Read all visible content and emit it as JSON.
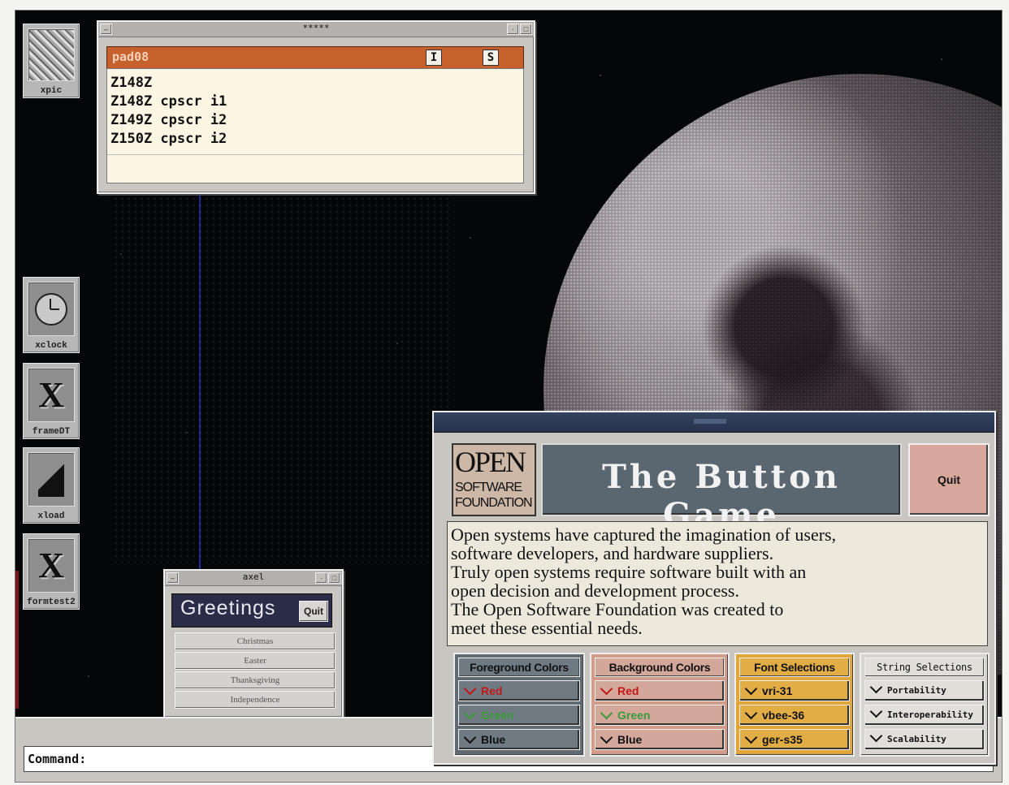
{
  "desktop": {
    "icons": [
      {
        "label": "xpic",
        "icon": "xpic-image-icon"
      },
      {
        "label": "xclock",
        "icon": "clock-icon"
      },
      {
        "label": "frameDT",
        "icon": "x-logo-icon"
      },
      {
        "label": "xload",
        "icon": "load-graph-icon"
      },
      {
        "label": "formtest2",
        "icon": "x-logo-icon"
      }
    ],
    "x_glyph": "X"
  },
  "pad_window": {
    "title": "*****",
    "header_name": "pad08",
    "flag_i": "I",
    "flag_s": "S",
    "lines": [
      "Z148Z",
      "Z148Z cpscr i1",
      "Z149Z cpscr i2",
      "Z150Z cpscr i2"
    ]
  },
  "axel_window": {
    "title": "axel",
    "heading": "Greetings",
    "quit_label": "Quit",
    "items": [
      "Christmas",
      "Easter",
      "Thanksgiving",
      "Independence"
    ]
  },
  "command_bar": {
    "label": "Command:"
  },
  "button_game": {
    "logo": {
      "open": "OPEN",
      "line2": "SOFTWARE",
      "line3": "FOUNDATION"
    },
    "title": "The Button Game",
    "quit_label": "Quit",
    "text_lines": [
      "Open systems have captured the imagination of users,",
      "software developers, and hardware suppliers.",
      "Truly open systems require software built with an",
      "open decision and development process.",
      "The Open Software Foundation was created to",
      "meet these essential needs."
    ],
    "groups": {
      "foreground": {
        "heading": "Foreground Colors",
        "items": [
          "Red",
          "Green",
          "Blue"
        ]
      },
      "background": {
        "heading": "Background Colors",
        "items": [
          "Red",
          "Green",
          "Blue"
        ]
      },
      "fonts": {
        "heading": "Font Selections",
        "items": [
          "vri-31",
          "vbee-36",
          "ger-s35"
        ]
      },
      "strings": {
        "heading": "String Selections",
        "items": [
          "Portability",
          "Interoperability",
          "Scalability"
        ]
      }
    }
  },
  "colors": {
    "pad_header": "#c6612e",
    "banner": "#5a6771",
    "quit_button": "#d6a79a",
    "font_group": "#e3ad45"
  }
}
